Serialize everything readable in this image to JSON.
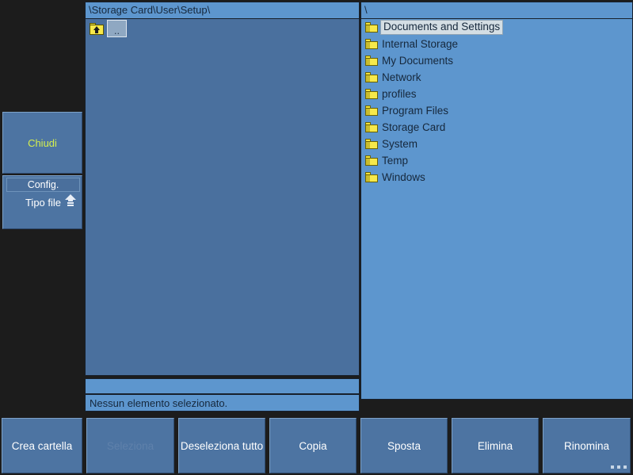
{
  "sidebar": {
    "close_button": {
      "label": "Chiudi"
    },
    "config_group": {
      "header_label": "Config.",
      "tipo_file_label": "Tipo file",
      "eject_icon": "eject-up-icon"
    }
  },
  "panel_left": {
    "path": "\\Storage Card\\User\\Setup\\",
    "up_entry": {
      "label": "..",
      "icon": "folder-up-icon"
    },
    "items": []
  },
  "panel_right": {
    "path": "\\",
    "items": [
      {
        "name": "Documents and Settings",
        "icon": "folder-icon",
        "selected": true
      },
      {
        "name": "Internal Storage",
        "icon": "folder-icon",
        "selected": false
      },
      {
        "name": "My Documents",
        "icon": "folder-icon",
        "selected": false
      },
      {
        "name": "Network",
        "icon": "folder-icon",
        "selected": false
      },
      {
        "name": "profiles",
        "icon": "folder-icon",
        "selected": false
      },
      {
        "name": "Program Files",
        "icon": "folder-icon",
        "selected": false
      },
      {
        "name": "Storage Card",
        "icon": "folder-icon",
        "selected": false
      },
      {
        "name": "System",
        "icon": "folder-icon",
        "selected": false
      },
      {
        "name": "Temp",
        "icon": "folder-icon",
        "selected": false
      },
      {
        "name": "Windows",
        "icon": "folder-icon",
        "selected": false
      }
    ]
  },
  "status": {
    "text": "Nessun elemento selezionato."
  },
  "toolbar": {
    "buttons": [
      {
        "label": "Crea cartella",
        "disabled": false
      },
      {
        "label": "Seleziona",
        "disabled": true
      },
      {
        "label": "Deseleziona tutto",
        "disabled": false
      },
      {
        "label": "Copia",
        "disabled": false
      },
      {
        "label": "Sposta",
        "disabled": false
      },
      {
        "label": "Elimina",
        "disabled": false
      },
      {
        "label": "Rinomina",
        "disabled": false
      }
    ],
    "more_indicator": "..."
  },
  "colors": {
    "background": "#1c1c1c",
    "panel_light": "#5d96ce",
    "panel_dark": "#4a709e",
    "button_face": "#4d74a2",
    "accent_text": "#d5ef4e",
    "folder_yellow": "#f7e94a"
  }
}
